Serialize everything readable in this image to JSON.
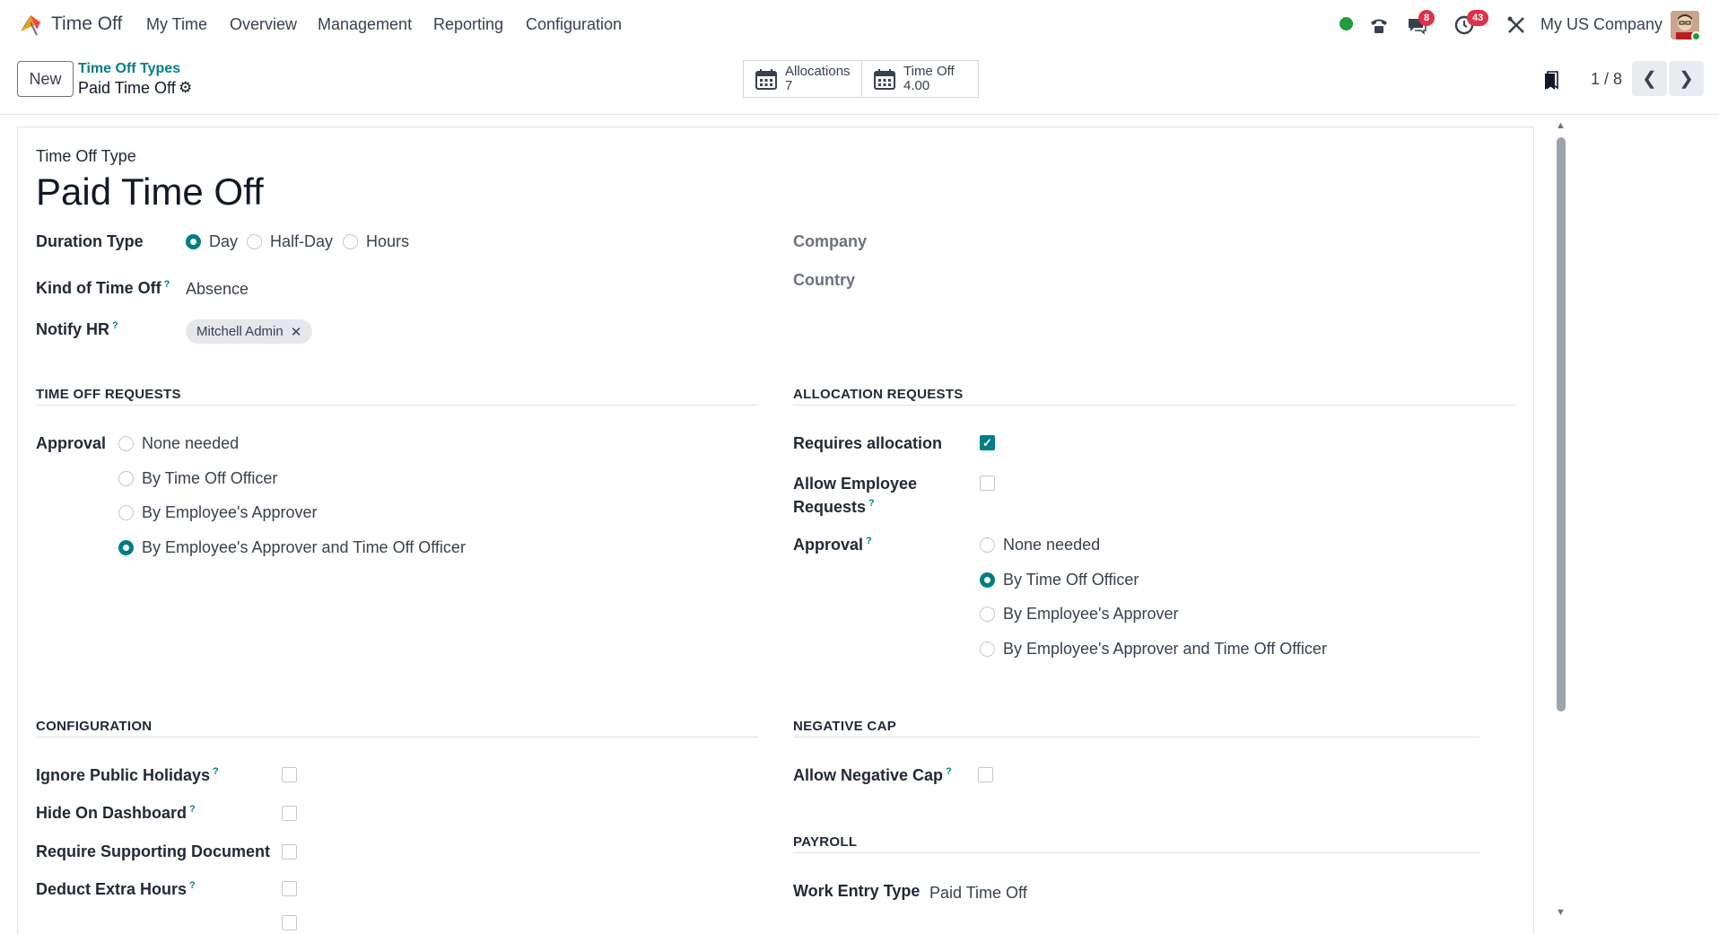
{
  "navbar": {
    "app_name": "Time Off",
    "menu": [
      "My Time",
      "Overview",
      "Management",
      "Reporting",
      "Configuration"
    ],
    "messages_badge": "8",
    "activities_badge": "43",
    "company": "My US Company",
    "status_color": "#1f9d3a"
  },
  "control_panel": {
    "new_label": "New",
    "breadcrumb_parent": "Time Off Types",
    "breadcrumb_current": "Paid Time Off",
    "smart_buttons": [
      {
        "label": "Allocations",
        "value": "7"
      },
      {
        "label": "Time Off",
        "value": "4.00"
      }
    ],
    "pager": "1 / 8"
  },
  "form": {
    "type_label": "Time Off Type",
    "title": "Paid Time Off",
    "duration_type_label": "Duration Type",
    "duration_options": [
      "Day",
      "Half-Day",
      "Hours"
    ],
    "duration_selected": "Day",
    "kind_label": "Kind of Time Off",
    "kind_value": "Absence",
    "notify_label": "Notify HR",
    "notify_tag": "Mitchell Admin",
    "company_label": "Company",
    "country_label": "Country",
    "time_off_requests": {
      "title": "TIME OFF REQUESTS",
      "approval_label": "Approval",
      "options": [
        "None needed",
        "By Time Off Officer",
        "By Employee's Approver",
        "By Employee's Approver and Time Off Officer"
      ],
      "selected": "By Employee's Approver and Time Off Officer"
    },
    "allocation_requests": {
      "title": "ALLOCATION REQUESTS",
      "requires_allocation_label": "Requires allocation",
      "requires_allocation": true,
      "allow_employee_label_1": "Allow Employee",
      "allow_employee_label_2": "Requests",
      "allow_employee": false,
      "approval_label": "Approval",
      "options": [
        "None needed",
        "By Time Off Officer",
        "By Employee's Approver",
        "By Employee's Approver and Time Off Officer"
      ],
      "selected": "By Time Off Officer"
    },
    "configuration": {
      "title": "CONFIGURATION",
      "fields": [
        {
          "label": "Ignore Public Holidays",
          "checked": false
        },
        {
          "label": "Hide On Dashboard",
          "checked": false
        },
        {
          "label": "Require Supporting Document",
          "checked": false
        },
        {
          "label": "Deduct Extra Hours",
          "checked": false
        }
      ]
    },
    "negative_cap": {
      "title": "NEGATIVE CAP",
      "allow_label": "Allow Negative Cap",
      "allow": false
    },
    "payroll": {
      "title": "PAYROLL",
      "work_entry_label": "Work Entry Type",
      "work_entry_value": "Paid Time Off"
    }
  },
  "colors": {
    "accent": "#017e84",
    "badge": "#e0314b"
  }
}
